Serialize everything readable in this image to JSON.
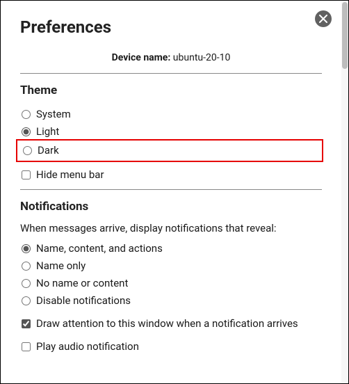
{
  "header": {
    "title": "Preferences",
    "device_label": "Device name:",
    "device_name": "ubuntu-20-10"
  },
  "theme": {
    "title": "Theme",
    "options": [
      "System",
      "Light",
      "Dark"
    ],
    "selected": "Light",
    "highlighted": "Dark",
    "hide_menu_label": "Hide menu bar",
    "hide_menu_checked": false
  },
  "notifications": {
    "title": "Notifications",
    "intro": "When messages arrive, display notifications that reveal:",
    "options": [
      "Name, content, and actions",
      "Name only",
      "No name or content",
      "Disable notifications"
    ],
    "selected": "Name, content, and actions",
    "draw_attention_label": "Draw attention to this window when a notification arrives",
    "draw_attention_checked": true,
    "play_audio_label": "Play audio notification",
    "play_audio_checked": false
  }
}
